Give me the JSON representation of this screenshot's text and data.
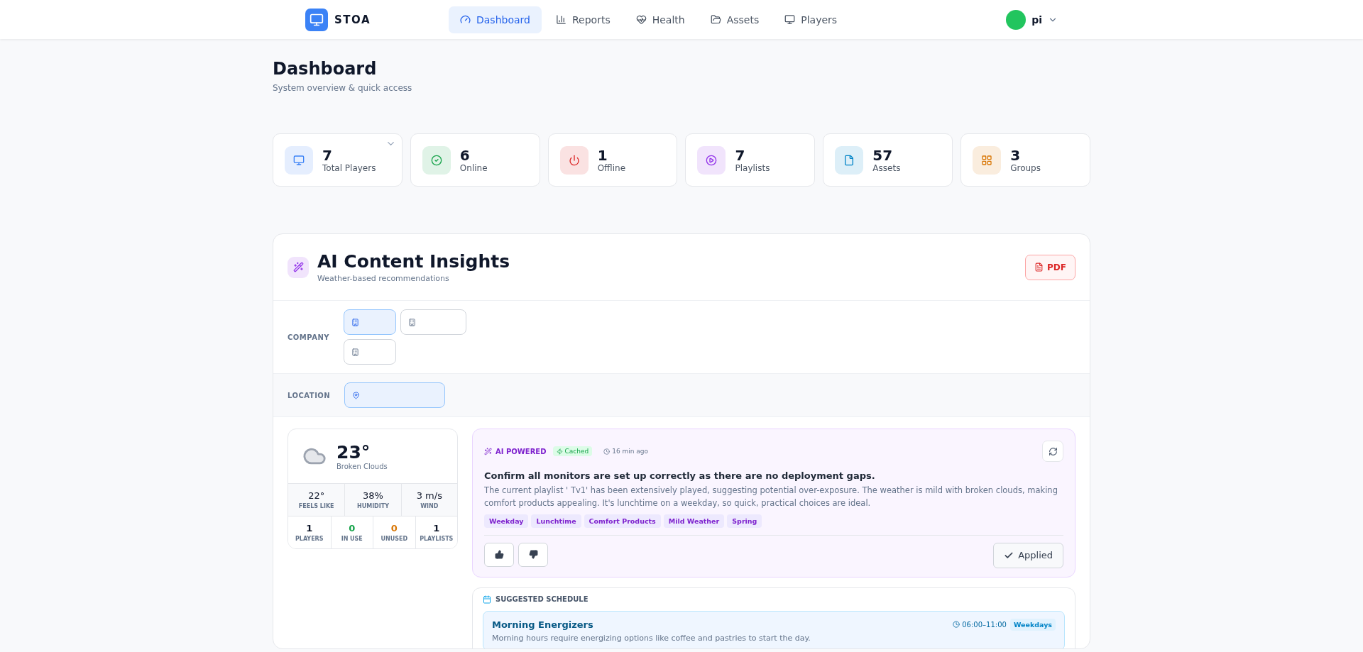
{
  "brand": {
    "name": "STOA"
  },
  "nav": [
    {
      "label": "Dashboard",
      "kind": "dashboard",
      "selected": true
    },
    {
      "label": "Reports",
      "kind": "reports",
      "selected": false
    },
    {
      "label": "Health",
      "kind": "health",
      "selected": false
    },
    {
      "label": "Assets",
      "kind": "assets",
      "selected": false
    },
    {
      "label": "Players",
      "kind": "players",
      "selected": false
    }
  ],
  "user": {
    "name": "pi"
  },
  "page": {
    "title": "Dashboard",
    "subtitle": "System overview & quick access"
  },
  "stats": [
    {
      "value": "7",
      "label": "Total Players",
      "kind": "players",
      "color": "#3b82f6",
      "has_menu": true
    },
    {
      "value": "6",
      "label": "Online",
      "kind": "online",
      "color": "#16a34a",
      "has_menu": false
    },
    {
      "value": "1",
      "label": "Offline",
      "kind": "offline",
      "color": "#dc2626",
      "has_menu": false
    },
    {
      "value": "7",
      "label": "Playlists",
      "kind": "playlists",
      "color": "#9333ea",
      "has_menu": false
    },
    {
      "value": "57",
      "label": "Assets",
      "kind": "assets",
      "color": "#0284c7",
      "has_menu": false
    },
    {
      "value": "3",
      "label": "Groups",
      "kind": "groups",
      "color": "#d97706",
      "has_menu": false
    }
  ],
  "insights": {
    "title": "AI Content Insights",
    "subtitle": "Weather-based recommendations",
    "pdf_button": "PDF",
    "company": {
      "label": "COMPANY",
      "options": [
        {
          "selected": true
        },
        {
          "selected": false
        },
        {
          "selected": false
        }
      ]
    },
    "location": {
      "label": "LOCATION",
      "options": [
        {
          "selected": true
        }
      ]
    },
    "weather": {
      "temperature": "23°",
      "condition": "Broken Clouds",
      "details": [
        {
          "value": "22°",
          "label": "FEELS LIKE"
        },
        {
          "value": "38%",
          "label": "HUMIDITY"
        },
        {
          "value": "3 m/s",
          "label": "WIND"
        }
      ],
      "counts": [
        {
          "value": "1",
          "label": "PLAYERS",
          "color": "#0f172a"
        },
        {
          "value": "0",
          "label": "IN USE",
          "color": "#16a34a"
        },
        {
          "value": "0",
          "label": "UNUSED",
          "color": "#d97706"
        },
        {
          "value": "1",
          "label": "PLAYLISTS",
          "color": "#0f172a"
        }
      ]
    },
    "recommendation": {
      "badge": "AI POWERED",
      "cache": "Cached",
      "time": "16 min ago",
      "headline": "Confirm all monitors are set up correctly as there are no deployment gaps.",
      "body": "The current playlist ' Tv1' has been extensively played, suggesting potential over-exposure. The weather is mild with broken clouds, making comfort products appealing. It's lunchtime on a weekday, so quick, practical choices are ideal.",
      "tags": [
        "Weekday",
        "Lunchtime",
        "Comfort Products",
        "Mild Weather",
        "Spring"
      ],
      "applied_button": "Applied"
    },
    "schedule": {
      "title": "SUGGESTED SCHEDULE",
      "items": [
        {
          "name": "Morning Energizers",
          "time": "06:00–11:00",
          "days": "Weekdays",
          "description": "Morning hours require energizing options like coffee and pastries to start the day."
        }
      ]
    }
  }
}
